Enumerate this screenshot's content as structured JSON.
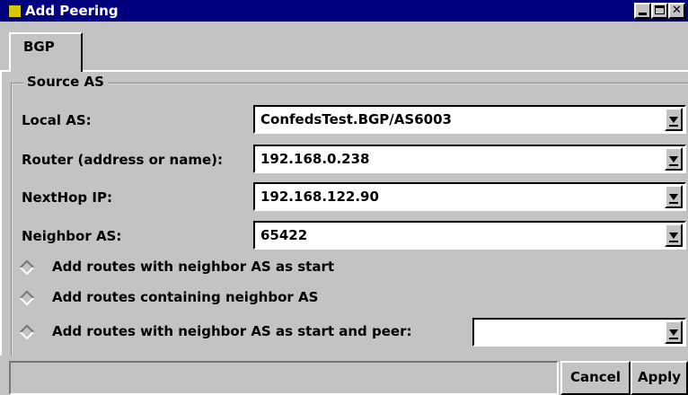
{
  "window": {
    "title": "Add Peering",
    "icon": "app-icon"
  },
  "tabs": [
    {
      "label": "BGP"
    }
  ],
  "group": {
    "legend": "Source AS"
  },
  "fields": {
    "local_as": {
      "label": "Local AS:",
      "value": "ConfedsTest.BGP/AS6003"
    },
    "router": {
      "label": "Router (address or name):",
      "value": "192.168.0.238"
    },
    "nexthop": {
      "label": "NextHop IP:",
      "value": "192.168.122.90"
    },
    "neighbor_as": {
      "label": "Neighbor AS:",
      "value": "65422"
    }
  },
  "radios": [
    {
      "label": "Add routes with neighbor AS as start"
    },
    {
      "label": "Add routes containing neighbor AS"
    },
    {
      "label": "Add routes with neighbor AS as start and peer:"
    }
  ],
  "peer_combo": {
    "value": ""
  },
  "buttons": {
    "cancel": "Cancel",
    "apply": "Apply"
  },
  "colors": {
    "titlebar": "#00007f",
    "background": "#c3c3c3"
  }
}
